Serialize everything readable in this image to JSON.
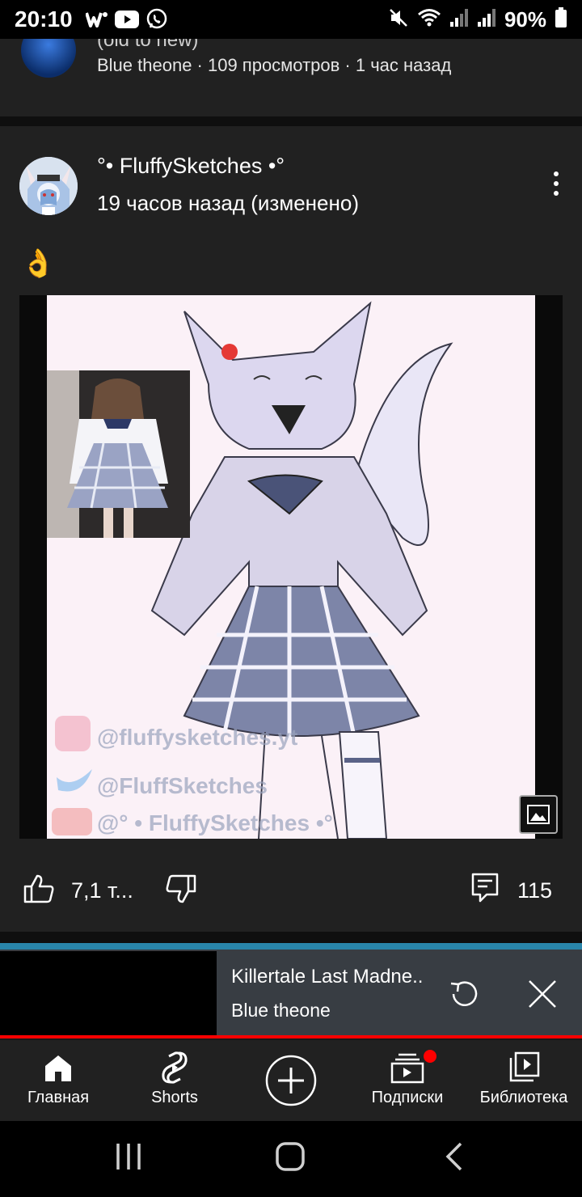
{
  "status_bar": {
    "time": "20:10",
    "battery": "90%",
    "icons": [
      "w-app-icon",
      "youtube-icon",
      "viber-icon",
      "mute-icon",
      "wifi-icon",
      "signal-icon",
      "signal-icon-2",
      "battery-icon"
    ]
  },
  "previous_post": {
    "title_partial": "(old to new)",
    "meta": "Blue theone · 109 просмотров · 1 час назад"
  },
  "post": {
    "channel": "°• FluffySketches •°",
    "time": "19 часов назад (изменено)",
    "text": "👌",
    "image_watermarks": [
      "@fluffysketches.yt",
      "@FluffSketches",
      "@° • FluffySketches •°"
    ],
    "likes": "7,1 т...",
    "comments": "115"
  },
  "mini_player": {
    "title": "Killertale Last Madne..",
    "channel": "Blue theone"
  },
  "bottom_nav": {
    "home": "Главная",
    "shorts": "Shorts",
    "subscriptions": "Подписки",
    "library": "Библиотека"
  },
  "colors": {
    "background": "#181818",
    "card": "#212121",
    "accent": "#ff0000"
  }
}
